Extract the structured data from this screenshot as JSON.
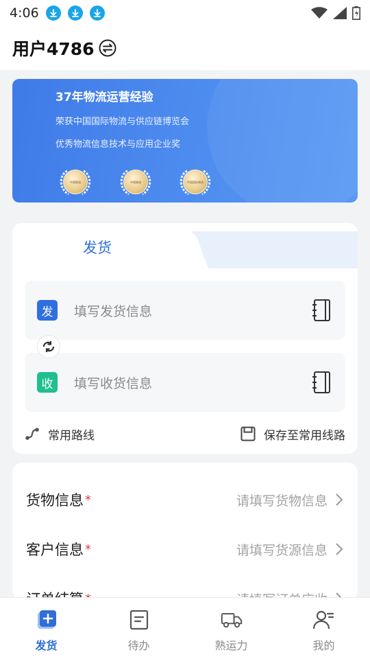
{
  "status_bar": {
    "time": "4:06",
    "icons": [
      "download-icon",
      "download-icon",
      "download-icon",
      "wifi-icon",
      "signal-icon",
      "battery-icon"
    ]
  },
  "header": {
    "title": "用户4786",
    "switch_icon": "switch-account-icon"
  },
  "banner": {
    "title": "37年物流运营经验",
    "line1": "荣获中国国际物流与供应链博览会",
    "line2": "优秀物流信息技术与应用企业奖",
    "medals": [
      {
        "text1": "中国物流",
        "text2": "行业最佳奖"
      },
      {
        "text1": "中国物流",
        "text2": "优秀奖项"
      },
      {
        "text1": "中国国际物流",
        "text2": "优秀信息技术奖"
      }
    ]
  },
  "ship_card": {
    "tab_active": "发货",
    "sender": {
      "badge": "发",
      "placeholder": "填写发货信息",
      "badge_color": "#2f6fe0"
    },
    "receiver": {
      "badge": "收",
      "placeholder": "填写收货信息",
      "badge_color": "#1fbf8f"
    },
    "common_route": "常用路线",
    "save_route": "保存至常用线路"
  },
  "info_card": {
    "rows": [
      {
        "label": "货物信息",
        "required": "*",
        "placeholder": "请填写货物信息"
      },
      {
        "label": "客户信息",
        "required": "*",
        "placeholder": "请填写货源信息"
      },
      {
        "label": "订单结算",
        "required": "*",
        "placeholder": "请填写订单应收"
      }
    ]
  },
  "bottom_nav": {
    "items": [
      {
        "label": "发货",
        "icon": "ship-plus-icon",
        "active": true
      },
      {
        "label": "待办",
        "icon": "todo-list-icon",
        "active": false
      },
      {
        "label": "熟运力",
        "icon": "truck-icon",
        "active": false
      },
      {
        "label": "我的",
        "icon": "profile-icon",
        "active": false
      }
    ]
  },
  "colors": {
    "accent": "#2f6fd6",
    "banner": "#4f8ef0",
    "required": "#e0413a"
  }
}
